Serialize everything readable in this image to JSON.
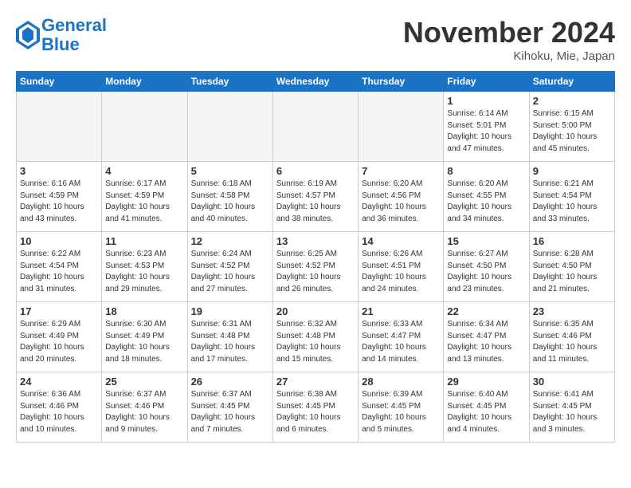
{
  "header": {
    "logo_line1": "General",
    "logo_line2": "Blue",
    "month": "November 2024",
    "location": "Kihoku, Mie, Japan"
  },
  "weekdays": [
    "Sunday",
    "Monday",
    "Tuesday",
    "Wednesday",
    "Thursday",
    "Friday",
    "Saturday"
  ],
  "weeks": [
    [
      {
        "day": "",
        "info": "",
        "empty": true
      },
      {
        "day": "",
        "info": "",
        "empty": true
      },
      {
        "day": "",
        "info": "",
        "empty": true
      },
      {
        "day": "",
        "info": "",
        "empty": true
      },
      {
        "day": "",
        "info": "",
        "empty": true
      },
      {
        "day": "1",
        "info": "Sunrise: 6:14 AM\nSunset: 5:01 PM\nDaylight: 10 hours\nand 47 minutes."
      },
      {
        "day": "2",
        "info": "Sunrise: 6:15 AM\nSunset: 5:00 PM\nDaylight: 10 hours\nand 45 minutes."
      }
    ],
    [
      {
        "day": "3",
        "info": "Sunrise: 6:16 AM\nSunset: 4:59 PM\nDaylight: 10 hours\nand 43 minutes."
      },
      {
        "day": "4",
        "info": "Sunrise: 6:17 AM\nSunset: 4:59 PM\nDaylight: 10 hours\nand 41 minutes."
      },
      {
        "day": "5",
        "info": "Sunrise: 6:18 AM\nSunset: 4:58 PM\nDaylight: 10 hours\nand 40 minutes."
      },
      {
        "day": "6",
        "info": "Sunrise: 6:19 AM\nSunset: 4:57 PM\nDaylight: 10 hours\nand 38 minutes."
      },
      {
        "day": "7",
        "info": "Sunrise: 6:20 AM\nSunset: 4:56 PM\nDaylight: 10 hours\nand 36 minutes."
      },
      {
        "day": "8",
        "info": "Sunrise: 6:20 AM\nSunset: 4:55 PM\nDaylight: 10 hours\nand 34 minutes."
      },
      {
        "day": "9",
        "info": "Sunrise: 6:21 AM\nSunset: 4:54 PM\nDaylight: 10 hours\nand 33 minutes."
      }
    ],
    [
      {
        "day": "10",
        "info": "Sunrise: 6:22 AM\nSunset: 4:54 PM\nDaylight: 10 hours\nand 31 minutes."
      },
      {
        "day": "11",
        "info": "Sunrise: 6:23 AM\nSunset: 4:53 PM\nDaylight: 10 hours\nand 29 minutes."
      },
      {
        "day": "12",
        "info": "Sunrise: 6:24 AM\nSunset: 4:52 PM\nDaylight: 10 hours\nand 27 minutes."
      },
      {
        "day": "13",
        "info": "Sunrise: 6:25 AM\nSunset: 4:52 PM\nDaylight: 10 hours\nand 26 minutes."
      },
      {
        "day": "14",
        "info": "Sunrise: 6:26 AM\nSunset: 4:51 PM\nDaylight: 10 hours\nand 24 minutes."
      },
      {
        "day": "15",
        "info": "Sunrise: 6:27 AM\nSunset: 4:50 PM\nDaylight: 10 hours\nand 23 minutes."
      },
      {
        "day": "16",
        "info": "Sunrise: 6:28 AM\nSunset: 4:50 PM\nDaylight: 10 hours\nand 21 minutes."
      }
    ],
    [
      {
        "day": "17",
        "info": "Sunrise: 6:29 AM\nSunset: 4:49 PM\nDaylight: 10 hours\nand 20 minutes."
      },
      {
        "day": "18",
        "info": "Sunrise: 6:30 AM\nSunset: 4:49 PM\nDaylight: 10 hours\nand 18 minutes."
      },
      {
        "day": "19",
        "info": "Sunrise: 6:31 AM\nSunset: 4:48 PM\nDaylight: 10 hours\nand 17 minutes."
      },
      {
        "day": "20",
        "info": "Sunrise: 6:32 AM\nSunset: 4:48 PM\nDaylight: 10 hours\nand 15 minutes."
      },
      {
        "day": "21",
        "info": "Sunrise: 6:33 AM\nSunset: 4:47 PM\nDaylight: 10 hours\nand 14 minutes."
      },
      {
        "day": "22",
        "info": "Sunrise: 6:34 AM\nSunset: 4:47 PM\nDaylight: 10 hours\nand 13 minutes."
      },
      {
        "day": "23",
        "info": "Sunrise: 6:35 AM\nSunset: 4:46 PM\nDaylight: 10 hours\nand 11 minutes."
      }
    ],
    [
      {
        "day": "24",
        "info": "Sunrise: 6:36 AM\nSunset: 4:46 PM\nDaylight: 10 hours\nand 10 minutes."
      },
      {
        "day": "25",
        "info": "Sunrise: 6:37 AM\nSunset: 4:46 PM\nDaylight: 10 hours\nand 9 minutes."
      },
      {
        "day": "26",
        "info": "Sunrise: 6:37 AM\nSunset: 4:45 PM\nDaylight: 10 hours\nand 7 minutes."
      },
      {
        "day": "27",
        "info": "Sunrise: 6:38 AM\nSunset: 4:45 PM\nDaylight: 10 hours\nand 6 minutes."
      },
      {
        "day": "28",
        "info": "Sunrise: 6:39 AM\nSunset: 4:45 PM\nDaylight: 10 hours\nand 5 minutes."
      },
      {
        "day": "29",
        "info": "Sunrise: 6:40 AM\nSunset: 4:45 PM\nDaylight: 10 hours\nand 4 minutes."
      },
      {
        "day": "30",
        "info": "Sunrise: 6:41 AM\nSunset: 4:45 PM\nDaylight: 10 hours\nand 3 minutes."
      }
    ]
  ]
}
